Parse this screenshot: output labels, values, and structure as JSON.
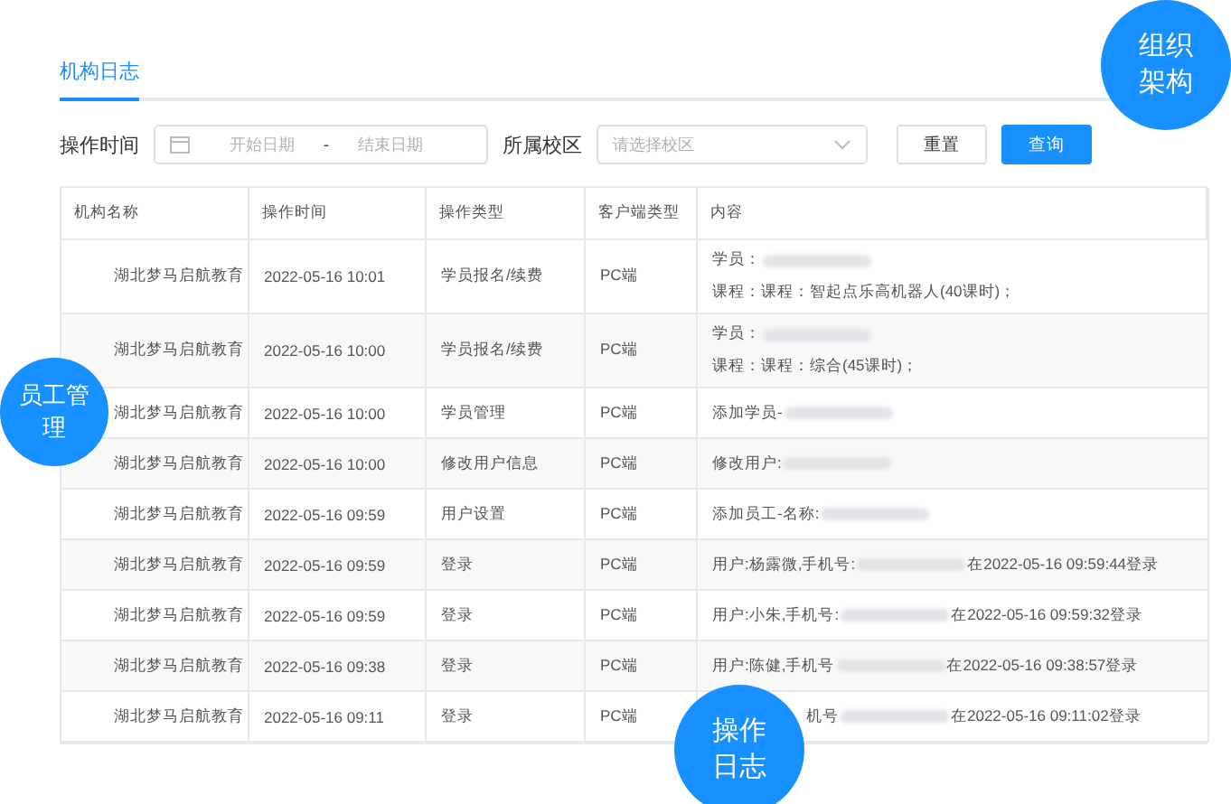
{
  "tabs": [
    {
      "label": "机构日志",
      "selected": true
    }
  ],
  "filters": {
    "time_label": "操作时间",
    "start_placeholder": "开始日期",
    "separator": "-",
    "end_placeholder": "结束日期",
    "campus_label": "所属校区",
    "campus_placeholder": "请选择校区",
    "reset": "重置",
    "query": "查询"
  },
  "table": {
    "columns": [
      "机构名称",
      "操作时间",
      "操作类型",
      "客户端类型",
      "内容"
    ],
    "rows": [
      {
        "org": "湖北梦马启航教育",
        "time": "2022-05-16 10:01",
        "type": "学员报名/续费",
        "client": "PC端",
        "content": [
          {
            "text": "学员：",
            "masked": true
          },
          {
            "text": "课程：课程：智起点乐高机器人(40课时)；",
            "masked": false
          }
        ]
      },
      {
        "org": "湖北梦马启航教育",
        "time": "2022-05-16 10:00",
        "type": "学员报名/续费",
        "client": "PC端",
        "content": [
          {
            "text": "学员：",
            "masked": true
          },
          {
            "text": "课程：课程：综合(45课时)；",
            "masked": false
          }
        ]
      },
      {
        "org": "湖北梦马启航教育",
        "time": "2022-05-16 10:00",
        "type": "学员管理",
        "client": "PC端",
        "content": [
          {
            "text": "添加学员-",
            "masked": true
          }
        ]
      },
      {
        "org": "湖北梦马启航教育",
        "time": "2022-05-16 10:00",
        "type": "修改用户信息",
        "client": "PC端",
        "content": [
          {
            "text": "修改用户:",
            "masked": true
          }
        ]
      },
      {
        "org": "湖北梦马启航教育",
        "time": "2022-05-16 09:59",
        "type": "用户设置",
        "client": "PC端",
        "content": [
          {
            "text": "添加员工-名称:",
            "masked": true
          }
        ]
      },
      {
        "org": "湖北梦马启航教育",
        "time": "2022-05-16 09:59",
        "type": "登录",
        "client": "PC端",
        "content": [
          {
            "text": "用户:杨露微,手机号:",
            "masked": true,
            "after": "在2022-05-16 09:59:44登录"
          }
        ]
      },
      {
        "org": "湖北梦马启航教育",
        "time": "2022-05-16 09:59",
        "type": "登录",
        "client": "PC端",
        "content": [
          {
            "text": "用户:小朱,手机号:",
            "masked": true,
            "after": "在2022-05-16 09:59:32登录"
          }
        ]
      },
      {
        "org": "湖北梦马启航教育",
        "time": "2022-05-16 09:38",
        "type": "登录",
        "client": "PC端",
        "content": [
          {
            "text": "用户:陈健,手机号",
            "masked": true,
            "after": "在2022-05-16 09:38:57登录"
          }
        ]
      },
      {
        "org": "湖北梦马启航教育",
        "time": "2022-05-16 09:11",
        "type": "登录",
        "client": "PC端",
        "content": [
          {
            "text": "机号",
            "masked": true,
            "covered": true,
            "after": "在2022-05-16 09:11:02登录"
          }
        ]
      }
    ]
  },
  "bubbles": [
    "组织架构",
    "员工管理",
    "操作日志"
  ]
}
